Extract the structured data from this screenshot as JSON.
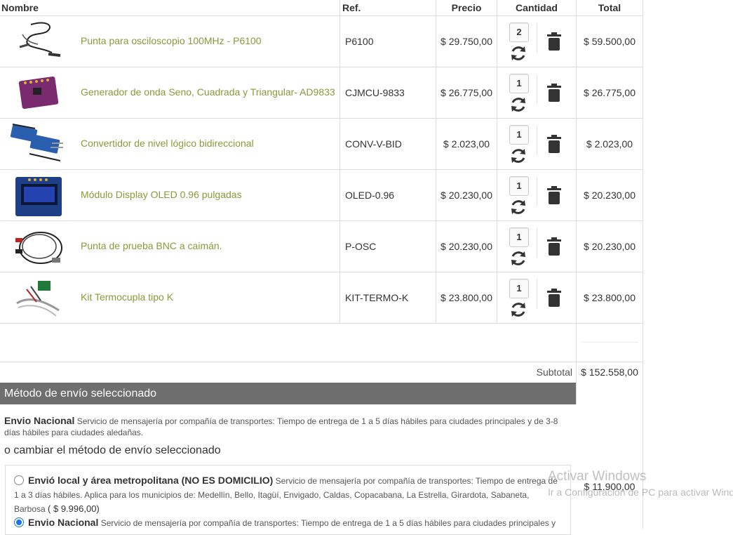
{
  "table": {
    "headers": {
      "name": "Nombre",
      "ref": "Ref.",
      "price": "Precio",
      "qty": "Cantidad",
      "total": "Total"
    },
    "rows": [
      {
        "name": "Punta para osciloscopio 100MHz - P6100",
        "ref": "P6100",
        "price": "$ 29.750,00",
        "qty": "2",
        "total": "$ 59.500,00",
        "image": "oscilloscope-probe"
      },
      {
        "name": "Generador de onda Seno, Cuadrada y Triangular- AD9833",
        "ref": "CJMCU-9833",
        "price": "$ 26.775,00",
        "qty": "1",
        "total": "$ 26.775,00",
        "image": "purple-pcb-module"
      },
      {
        "name": "Convertidor de nivel lógico bidireccional",
        "ref": "CONV-V-BID",
        "price": "$ 2.023,00",
        "qty": "1",
        "total": "$ 2.023,00",
        "image": "blue-level-shifter-boards"
      },
      {
        "name": "Módulo Display OLED 0.96 pulgadas",
        "ref": "OLED-0.96",
        "price": "$ 20.230,00",
        "qty": "1",
        "total": "$ 20.230,00",
        "image": "oled-display-module"
      },
      {
        "name": "Punta de prueba BNC a caimán.",
        "ref": "P-OSC",
        "price": "$ 20.230,00",
        "qty": "1",
        "total": "$ 20.230,00",
        "image": "bnc-alligator-cable"
      },
      {
        "name": "Kit Termocupla tipo K",
        "ref": "KIT-TERMO-K",
        "price": "$ 23.800,00",
        "qty": "1",
        "total": "$ 23.800,00",
        "image": "thermocouple-kit"
      }
    ]
  },
  "subtotal": {
    "label": "Subtotal",
    "value": "$ 152.558,00"
  },
  "shipping": {
    "title": "Método de envío seleccionado",
    "selected_name": "Envio Nacional",
    "selected_desc": "Servicio de mensajería por compañía de transportes: Tiempo de entrega de 1 a 5 días hábiles para ciudades principales y de 3-8 días hábiles para ciudades aledañas.",
    "change_label": "o cambiar el método de envío seleccionado",
    "options": [
      {
        "name": "Envió local y área metropolitana (NO ES DOMICILIO)",
        "desc": "Servicio de mensajería por compañía de transportes: Tiempo de entrega de 1 a 3 días hábiles. Aplica para los municipios de: Medellín, Bello, Itagüí, Envigado, Caldas, Copacabana, La Estrella, Girardota, Sabaneta, Barbosa",
        "price": "( $ 9.996,00)",
        "selected": false
      },
      {
        "name": "Envio Nacional",
        "desc": "Servicio de mensajería por compañía de transportes: Tiempo de entrega de 1 a 5 días hábiles para ciudades principales y",
        "selected": true
      }
    ],
    "cost": "$ 11.900,00"
  },
  "watermark": {
    "line1": "Activar Windows",
    "line2": "Ir a Configuración de PC para activar Windows."
  },
  "colors": {
    "link": "#8a9a3a",
    "bar": "#6e6e6e",
    "radio": "#1a73e8"
  }
}
